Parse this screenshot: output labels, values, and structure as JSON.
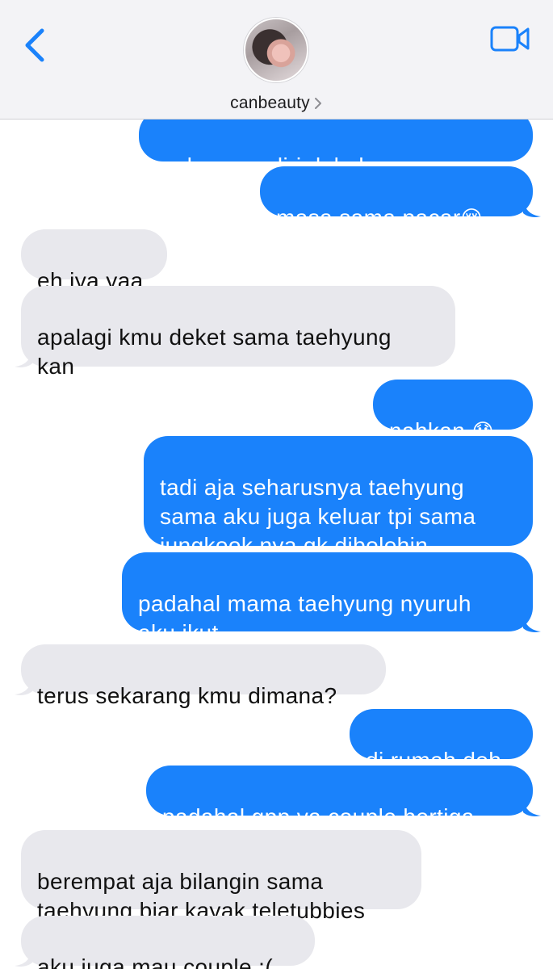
{
  "header": {
    "contact_name": "canbeauty",
    "back_icon": "chevron-left-icon",
    "video_icon": "video-camera-icon",
    "accent": "#1a82fb"
  },
  "messages": [
    {
      "sender": "me",
      "text": "sodara sendiri dulu kan"
    },
    {
      "sender": "me",
      "text": "masa sama pacar",
      "emoji": "😢"
    },
    {
      "sender": "them",
      "text": "eh iya yaa"
    },
    {
      "sender": "them",
      "text": "apalagi kmu deket sama taehyung\nkan"
    },
    {
      "sender": "me",
      "text": "nahkan ",
      "emoji": "😓"
    },
    {
      "sender": "me",
      "text": "tadi aja seharusnya taehyung\nsama aku juga keluar tpi sama\njungkook nya gk dibolehin"
    },
    {
      "sender": "me",
      "text": "padahal mama taehyung nyuruh\naku ikut"
    },
    {
      "sender": "them",
      "text": "terus sekarang kmu dimana?"
    },
    {
      "sender": "me",
      "text": "di rumah deh"
    },
    {
      "sender": "me",
      "text": "padahal gpp ya couple bertiga"
    },
    {
      "sender": "them",
      "text": "berempat aja bilangin sama\ntaehyung biar kayak teletubbies"
    },
    {
      "sender": "them",
      "text": "aku juga mau couple :("
    }
  ],
  "colors": {
    "outgoing_bubble": "#1a82fb",
    "incoming_bubble": "#e8e8ed",
    "header_bg": "#f3f3f6"
  }
}
